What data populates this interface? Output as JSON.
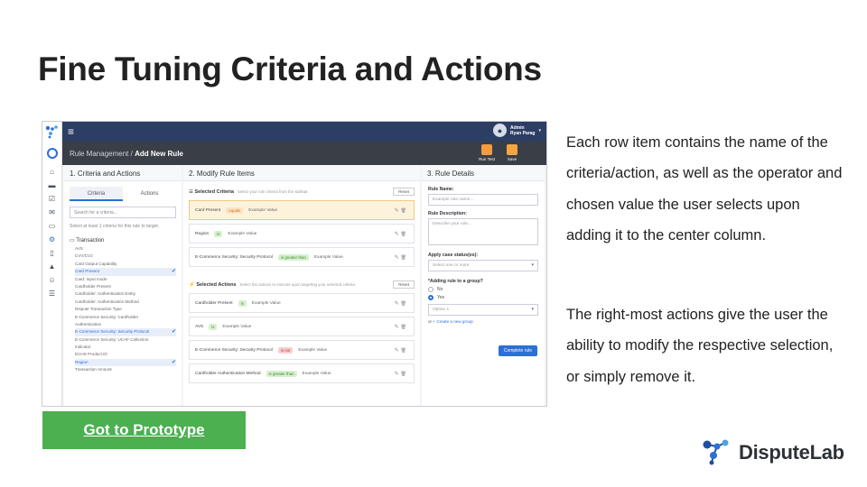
{
  "slide": {
    "title": "Fine Tuning Criteria and Actions",
    "prototype_button": "Got to Prototype",
    "description_1": "Each row item contains the name of the criteria/action, as well as the operator and chosen value the user selects upon adding it to the center column.",
    "description_2": "The right-most actions give the user the ability to modify the respective selection, or simply remove it.",
    "brand": "DisputeLab"
  },
  "app": {
    "user_role": "Admin",
    "user_name": "Ryan Parag",
    "breadcrumb_parent": "Rule Management",
    "breadcrumb_sep": "/",
    "breadcrumb_current": "Add New Rule",
    "run_test": "Run Test",
    "save": "Save",
    "col1": {
      "title": "1. Criteria and Actions",
      "tab_criteria": "Criteria",
      "tab_actions": "Actions",
      "search_placeholder": "Search for a criteria...",
      "hint": "Select at least 1 criteria for this rule to target.",
      "group": "Transaction",
      "items": [
        {
          "label": "AVS",
          "selected": false
        },
        {
          "label": "CVV/CV2",
          "selected": false
        },
        {
          "label": "Card Output Capability",
          "selected": false
        },
        {
          "label": "Card Present",
          "selected": true
        },
        {
          "label": "Card: Input mode",
          "selected": false
        },
        {
          "label": "Cardholder Present",
          "selected": false
        },
        {
          "label": "Cardholder: Authentication Entity",
          "selected": false
        },
        {
          "label": "Cardholder: Authentication Method",
          "selected": false
        },
        {
          "label": "Dispute Transaction Type",
          "selected": false
        },
        {
          "label": "E-Commerce Security: Cardholder",
          "selected": false
        },
        {
          "label": "Authentication",
          "selected": false
        },
        {
          "label": "E-Commerce Security: Security Protocol",
          "selected": true
        },
        {
          "label": "E-Commerce Security: UCAF Collection",
          "selected": false
        },
        {
          "label": "Indicator",
          "selected": false
        },
        {
          "label": "ECHS Product ID",
          "selected": false
        },
        {
          "label": "Region",
          "selected": true
        },
        {
          "label": "Transaction Amount",
          "selected": false
        }
      ]
    },
    "col2": {
      "title": "2. Modify Rule Items",
      "criteria_header": "Selected Criteria",
      "criteria_hint": "Select your rule criteria from the sidebar.",
      "actions_header": "Selected Actions",
      "actions_hint": "Select the actions to execute upon targeting your selected criteria.",
      "reset": "Reset",
      "criteria": [
        {
          "name": "Card Present",
          "op": "equals",
          "op_color": "orange",
          "value": "Example Value",
          "highlight": true
        },
        {
          "name": "Region",
          "op": "is",
          "op_color": "green",
          "value": "Example Value",
          "highlight": false
        },
        {
          "name": "E-Commerce Security: Security Protocol",
          "op": "is greater than",
          "op_color": "green",
          "value": "Example Value",
          "highlight": false
        }
      ],
      "actions": [
        {
          "name": "Cardholder Present",
          "op": "is",
          "op_color": "green",
          "value": "Example Value"
        },
        {
          "name": "AVS",
          "op": "is",
          "op_color": "green",
          "value": "Example Value"
        },
        {
          "name": "E-Commerce Security: Security Protocol",
          "op": "is not",
          "op_color": "red",
          "value": "Example Value"
        },
        {
          "name": "Cardholder Authentication Method",
          "op": "is greater than",
          "op_color": "green",
          "value": "Example Value"
        }
      ]
    },
    "col3": {
      "title": "3. Rule Details",
      "name_label": "Rule Name:",
      "name_placeholder": "Example rule name...",
      "desc_label": "Rule Description:",
      "desc_placeholder": "Describe your rule...",
      "case_label": "Apply case status(es):",
      "case_placeholder": "Select one or more",
      "group_label": "*Adding rule to a group?",
      "no": "No",
      "yes": "Yes",
      "option": "Option 1",
      "or": "or",
      "create_group": "+ Create a new group",
      "complete": "Complete rule"
    }
  },
  "colors": {
    "accent": "#2c6fd6",
    "topbar": "#2c3e63",
    "button": "#4caf50"
  }
}
